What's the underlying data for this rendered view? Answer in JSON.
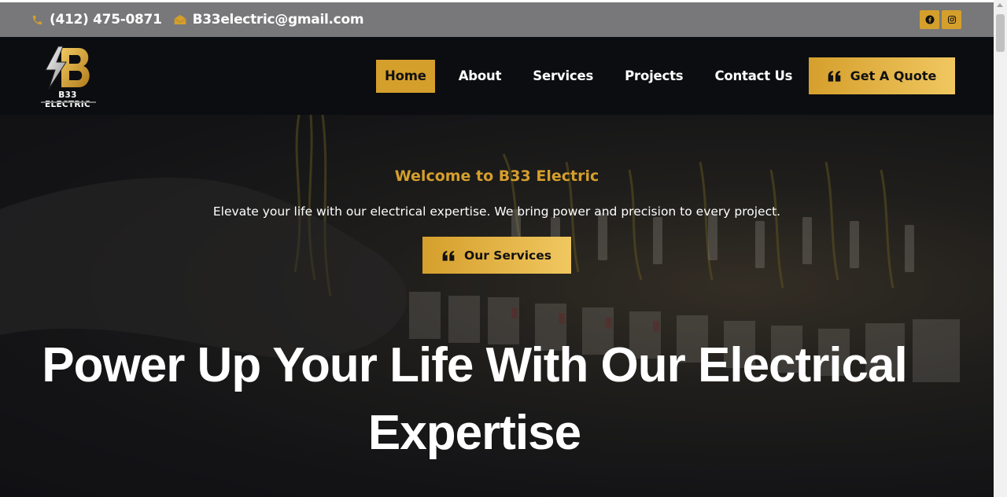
{
  "topbar": {
    "phone": "(412) 475-0871",
    "email": "B33electric@gmail.com",
    "phone_icon": "phone-icon",
    "email_icon": "envelope-icon",
    "social": [
      "facebook-icon",
      "instagram-icon"
    ]
  },
  "header": {
    "logo_text": "B33 ELECTRIC",
    "nav": [
      {
        "label": "Home",
        "active": true
      },
      {
        "label": "About"
      },
      {
        "label": "Services"
      },
      {
        "label": "Projects"
      },
      {
        "label": "Contact Us"
      }
    ],
    "quote_button": "Get A Quote"
  },
  "hero": {
    "welcome": "Welcome to B33 Electric",
    "tagline": "Elevate your life with our electrical expertise. We bring power and precision to every project.",
    "services_button": "Our Services",
    "headline_line1": "Power Up Your Life With Our Electrical",
    "headline_line2": "Expertise"
  },
  "colors": {
    "accent": "#d59f2c",
    "accent_light": "#f0c760",
    "topbar": "#78787a",
    "navbar": "#0c0d10"
  }
}
